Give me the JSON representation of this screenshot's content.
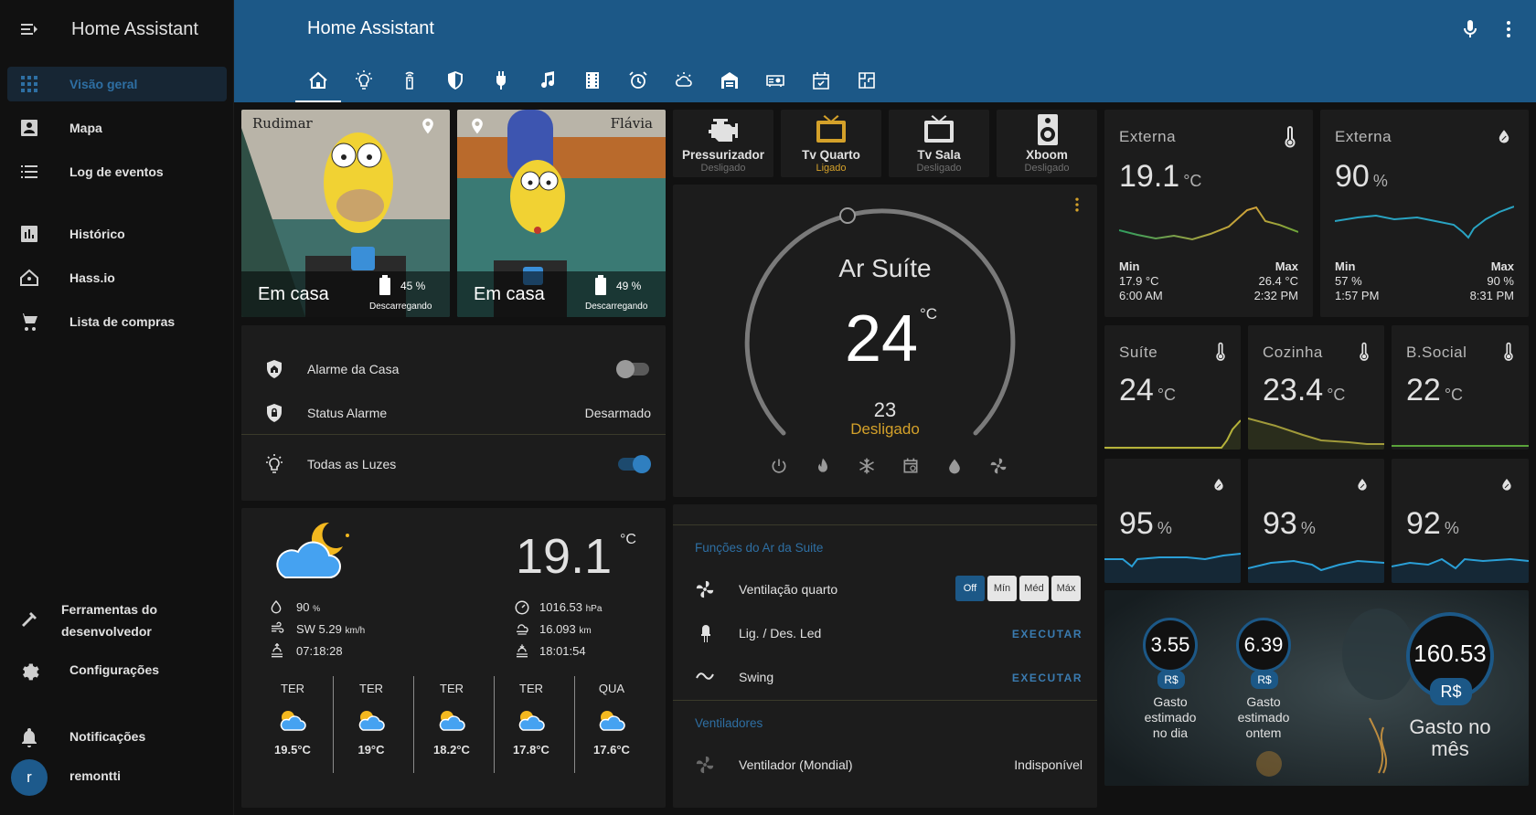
{
  "app": {
    "title": "Home Assistant"
  },
  "sidebar": {
    "title": "Home Assistant",
    "items": [
      {
        "label": "Visão geral",
        "icon": "view-dashboard-icon"
      },
      {
        "label": "Mapa",
        "icon": "account-box-icon"
      },
      {
        "label": "Log de eventos",
        "icon": "format-list-bulleted-icon"
      },
      {
        "label": "Histórico",
        "icon": "chart-box-icon"
      },
      {
        "label": "Hass.io",
        "icon": "home-assistant-icon"
      },
      {
        "label": "Lista de compras",
        "icon": "cart-icon"
      }
    ],
    "dev_tools_line1": "Ferramentas do",
    "dev_tools_line2": "desenvolvedor",
    "settings": "Configurações",
    "notifications": "Notificações",
    "user": "remontti",
    "avatar_letter": "r"
  },
  "header": {
    "title": "Home Assistant",
    "tabs": [
      "home-icon",
      "lightbulb-icon",
      "remote-icon",
      "shield-icon",
      "power-plug-icon",
      "music-icon",
      "film-icon",
      "alarm-icon",
      "weather-icon",
      "garage-icon",
      "projector-icon",
      "calendar-check-icon",
      "floor-plan-icon"
    ]
  },
  "persons": [
    {
      "name_overlay": "Rudimar",
      "state": "Em casa",
      "battery": "45 %",
      "battery_state": "Descarregando"
    },
    {
      "name_overlay": "Flávia",
      "state": "Em casa",
      "battery": "49 %",
      "battery_state": "Descarregando"
    }
  ],
  "alarm": {
    "alarm_label": "Alarme da Casa",
    "status_label": "Status Alarme",
    "status_value": "Desarmado",
    "lights_label": "Todas as Luzes",
    "alarm_on": false,
    "lights_on": true
  },
  "weather": {
    "temp": "19.1",
    "unit": "°C",
    "humidity": "90",
    "humidity_unit": "%",
    "wind": "SW 5.29",
    "wind_unit": "km/h",
    "sunrise": "07:18:28",
    "pressure": "1016.53",
    "pressure_unit": "hPa",
    "visibility": "16.093",
    "visibility_unit": "km",
    "sunset": "18:01:54",
    "forecast": [
      {
        "day": "TER",
        "temp": "19.5°C"
      },
      {
        "day": "TER",
        "temp": "19°C"
      },
      {
        "day": "TER",
        "temp": "18.2°C"
      },
      {
        "day": "TER",
        "temp": "17.8°C"
      },
      {
        "day": "QUA",
        "temp": "17.6°C"
      }
    ]
  },
  "devices": [
    {
      "name": "Pressurizador",
      "state": "Desligado",
      "active": false
    },
    {
      "name": "Tv Quarto",
      "state": "Ligado",
      "active": true
    },
    {
      "name": "Tv Sala",
      "state": "Desligado",
      "active": false
    },
    {
      "name": "Xboom",
      "state": "Desligado",
      "active": false
    }
  ],
  "thermostat": {
    "name": "Ar Suíte",
    "current": "24",
    "unit": "°C",
    "target": "23",
    "state": "Desligado",
    "modes": [
      "power-icon",
      "fire-icon",
      "snowflake-icon",
      "calendar-sync-icon",
      "water-percent-icon",
      "fan-icon"
    ]
  },
  "ac_functions": {
    "section1": "Funções do Ar da Suite",
    "fan_label": "Ventilação quarto",
    "fan_options": [
      "Off",
      "Mín",
      "Méd",
      "Máx"
    ],
    "fan_selected": "Off",
    "led_label": "Lig. / Des. Led",
    "swing_label": "Swing",
    "execute": "EXECUTAR",
    "section2": "Ventiladores",
    "fan2_label": "Ventilador (Mondial)",
    "fan2_state": "Indisponível"
  },
  "sensors_big": [
    {
      "name": "Externa",
      "value": "19.1",
      "unit": "°C",
      "min_label": "Min",
      "max_label": "Max",
      "min": "17.9 °C",
      "max": "26.4 °C",
      "min_time": "6:00 AM",
      "max_time": "2:32 PM",
      "icon": "thermometer-icon"
    },
    {
      "name": "Externa",
      "value": "90",
      "unit": "%",
      "min_label": "Min",
      "max_label": "Max",
      "min": "57 %",
      "max": "90 %",
      "min_time": "1:57 PM",
      "max_time": "8:31 PM",
      "icon": "water-percent-icon"
    }
  ],
  "sensors_temp": [
    {
      "name": "Suíte",
      "value": "24",
      "unit": "°C"
    },
    {
      "name": "Cozinha",
      "value": "23.4",
      "unit": "°C"
    },
    {
      "name": "B.Social",
      "value": "22",
      "unit": "°C"
    }
  ],
  "sensors_hum": [
    {
      "value": "95",
      "unit": "%"
    },
    {
      "value": "93",
      "unit": "%"
    },
    {
      "value": "92",
      "unit": "%"
    }
  ],
  "energy": {
    "currency": "R$",
    "day_value": "3.55",
    "day_label": [
      "Gasto",
      "estimado",
      "no dia"
    ],
    "yesterday_value": "6.39",
    "yesterday_label": [
      "Gasto",
      "estimado",
      "ontem"
    ],
    "month_value": "160.53",
    "month_label": [
      "Gasto no",
      "mês"
    ]
  },
  "colors": {
    "header": "#1c5887",
    "accent": "#2e6fa3",
    "active_device": "#d4a12a",
    "card": "#1c1c1c"
  }
}
